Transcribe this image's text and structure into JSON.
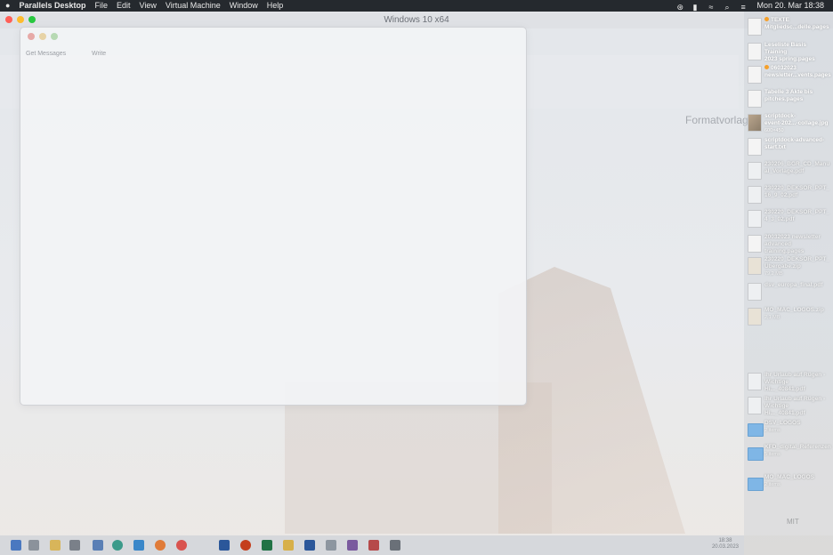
{
  "menubar": {
    "apple": "",
    "app": "Parallels Desktop",
    "items": [
      "File",
      "Edit",
      "View",
      "Virtual Machine",
      "Window",
      "Help"
    ],
    "clock": "Mon 20. Mar  18:38"
  },
  "vm_window": {
    "title": "Windows 10 x64"
  },
  "background": {
    "side_heading": "Formatvorlagen",
    "stamp": "MIT"
  },
  "front_window": {
    "toolbar": [
      "Get Messages",
      "Write"
    ]
  },
  "taskbar": {
    "time": "18:38",
    "date": "20.03.2023"
  },
  "dock_items": [
    {
      "label": "TEXTE\nMitgliedsc...delle.pages",
      "icon": "document-icon",
      "tag": true
    },
    {
      "label": "Leseliste Basis Training\n2023 spring.pages",
      "icon": "document-icon"
    },
    {
      "label": "06032023\nnewsletter...vents.pages",
      "icon": "document-icon",
      "tag": true
    },
    {
      "label": "Tabelle 3 Akte bis\npitches.pages",
      "icon": "document-icon"
    },
    {
      "label": "scriptdock-\nevent-202...-collage.jpg",
      "meta": "600×450",
      "icon": "image-icon"
    },
    {
      "label": "scriptdock-advanced-\nstart.txt",
      "icon": "document-icon"
    },
    {
      "label": "230206_BGR_CD_Manu\nal_Vorlage.pdf",
      "icon": "pdf-icon",
      "faded": true
    },
    {
      "label": "230220_DEKSOR_PPT_\n16_9_02.pdf",
      "icon": "pdf-icon",
      "faded": true
    },
    {
      "label": "230220_DEKSOR_PPT_\n4_3_02.pdf",
      "icon": "pdf-icon",
      "faded": true
    },
    {
      "label": "20032023 newsletter\nadvanced training.pages",
      "icon": "document-icon",
      "faded": true
    },
    {
      "label": "230220_DEKSOR_PPT_\nÜbergabe.zip",
      "meta": "79,2 MB",
      "icon": "zip-icon",
      "faded": true
    },
    {
      "label": "dsv_europa_final.pdf",
      "icon": "pdf-icon",
      "faded": true
    },
    {
      "label": "MO_MAC_LOGOS.zip",
      "meta": "2,1 MB",
      "icon": "zip-icon",
      "faded": true
    },
    {
      "label": "Ihr Urlaub auf Rügen -\nWichtige Hi..._40841.pdf",
      "icon": "pdf-icon",
      "faded": true
    },
    {
      "label": "Ihr Urlaub auf Rügen -\nWichtige Hi..._40841.pdf",
      "icon": "pdf-icon",
      "faded": true
    },
    {
      "label": "DSV_LOGOS",
      "meta": "2 items",
      "icon": "folder-icon",
      "faded": true
    },
    {
      "label": "KFD_digital_Referenzen",
      "meta": "5 items",
      "icon": "folder-icon",
      "faded": true
    },
    {
      "label": "MO_MAC_LOGOS",
      "meta": "2 items",
      "icon": "folder-icon",
      "faded": true
    }
  ],
  "colors": {
    "menubar": "#25292e",
    "close": "#ff5f57",
    "minimize": "#febc2e",
    "zoom": "#28c840",
    "tag": "#f5a02b",
    "folder": "#7fb6e6"
  }
}
